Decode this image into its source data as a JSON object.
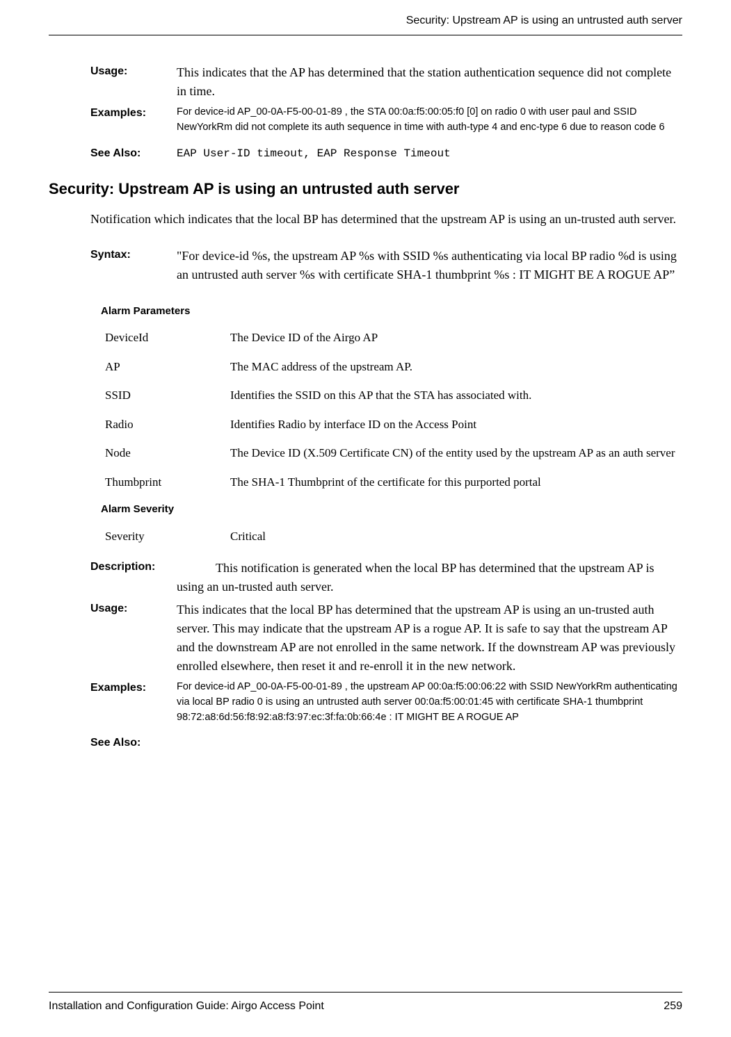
{
  "header": {
    "title": "Security: Upstream AP is using an untrusted auth server"
  },
  "topBlock": {
    "usage": {
      "label": "Usage:",
      "text": "This indicates that the AP has determined that the station authentication sequence did not complete in time."
    },
    "examples": {
      "label": "Examples:",
      "text": "For device-id AP_00-0A-F5-00-01-89 , the STA 00:0a:f5:00:05:f0 [0] on radio 0 with user paul and SSID NewYorkRm did not complete its auth sequence in time with auth-type 4 and enc-type 6 due to reason code 6"
    },
    "seeAlso": {
      "label": "See Also:",
      "text": "EAP User-ID timeout, EAP Response Timeout"
    }
  },
  "section": {
    "heading": "Security: Upstream AP is using an untrusted auth server",
    "intro": "Notification which indicates that the local BP has determined that the upstream AP is using an un-trusted auth server.",
    "syntax": {
      "label": "Syntax:",
      "text": "\"For device-id %s, the upstream AP %s with SSID %s authenticating via local BP radio %d is using an untrusted auth server %s with certificate SHA-1 thumbprint %s : IT MIGHT BE A ROGUE AP”"
    },
    "paramsHeading": "Alarm Parameters",
    "params": [
      {
        "name": "DeviceId",
        "desc": "The Device ID of the Airgo AP"
      },
      {
        "name": "AP",
        "desc": "The MAC address of the upstream AP."
      },
      {
        "name": "SSID",
        "desc": "Identifies the SSID on this AP that the STA has associated with."
      },
      {
        "name": "Radio",
        "desc": "Identifies Radio by interface ID on the Access Point"
      },
      {
        "name": "Node",
        "desc": "The Device ID (X.509 Certificate CN) of the entity used by the upstream AP as an auth server"
      },
      {
        "name": "Thumbprint",
        "desc": "The SHA-1 Thumbprint of the certificate for this purported portal"
      }
    ],
    "severityHeading": "Alarm Severity",
    "severity": {
      "name": "Severity",
      "desc": "Critical"
    },
    "description": {
      "label": "Description:",
      "text": "This notification is generated when the local BP has determined that the upstream AP is using an un-trusted auth server."
    },
    "usage": {
      "label": "Usage:",
      "text": "This indicates that the local BP has determined that the upstream AP is using an un-trusted auth server.  This may indicate that the upstream AP is a rogue AP. It is safe to say that the upstream AP and the downstream AP are not enrolled in the same network. If the downstream AP was previously enrolled elsewhere, then reset it and re-enroll it in the new network."
    },
    "examples": {
      "label": "Examples:",
      "text": "For device-id AP_00-0A-F5-00-01-89 , the upstream AP 00:0a:f5:00:06:22 with SSID NewYorkRm authenticating via local BP radio 0 is using an untrusted auth server 00:0a:f5:00:01:45 with certificate SHA-1 thumbprint 98:72:a8:6d:56:f8:92:a8:f3:97:ec:3f:fa:0b:66:4e : IT MIGHT BE A ROGUE AP"
    },
    "seeAlso": {
      "label": "See Also:",
      "text": ""
    }
  },
  "footer": {
    "left": "Installation and Configuration Guide: Airgo Access Point",
    "right": "259"
  }
}
